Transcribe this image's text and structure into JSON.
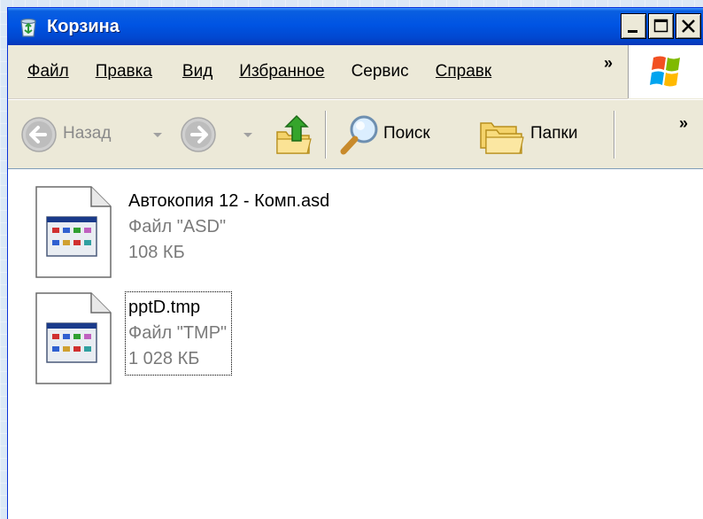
{
  "window": {
    "title": "Корзина",
    "buttons": {
      "minimize": "_",
      "maximize": "□",
      "close": "×"
    }
  },
  "menu": {
    "items": [
      {
        "label": "Файл",
        "underline_index": 0
      },
      {
        "label": "Правка",
        "underline_index": 0
      },
      {
        "label": "Вид",
        "underline_index": 0
      },
      {
        "label": "Избранное",
        "underline_index": 0
      },
      {
        "label": "Сервис",
        "underline_index": 1
      },
      {
        "label": "Справк",
        "underline_index": 0
      }
    ],
    "more": "»"
  },
  "toolbar": {
    "back_label": "Назад",
    "search_label": "Поиск",
    "folders_label": "Папки",
    "more": "»"
  },
  "files": [
    {
      "name": "Автокопия 12 - Комп.asd",
      "type": "Файл \"ASD\"",
      "size": "108 КБ",
      "selected": false,
      "icon": "asd-file-icon"
    },
    {
      "name": "pptD.tmp",
      "type": "Файл \"TMP\"",
      "size": "1 028 КБ",
      "selected": true,
      "icon": "tmp-file-icon"
    }
  ],
  "colors": {
    "titlebar": "#0054e3",
    "window_face": "#ece9d8",
    "content_bg": "#ffffff",
    "meta_text": "#7a7a7a"
  }
}
